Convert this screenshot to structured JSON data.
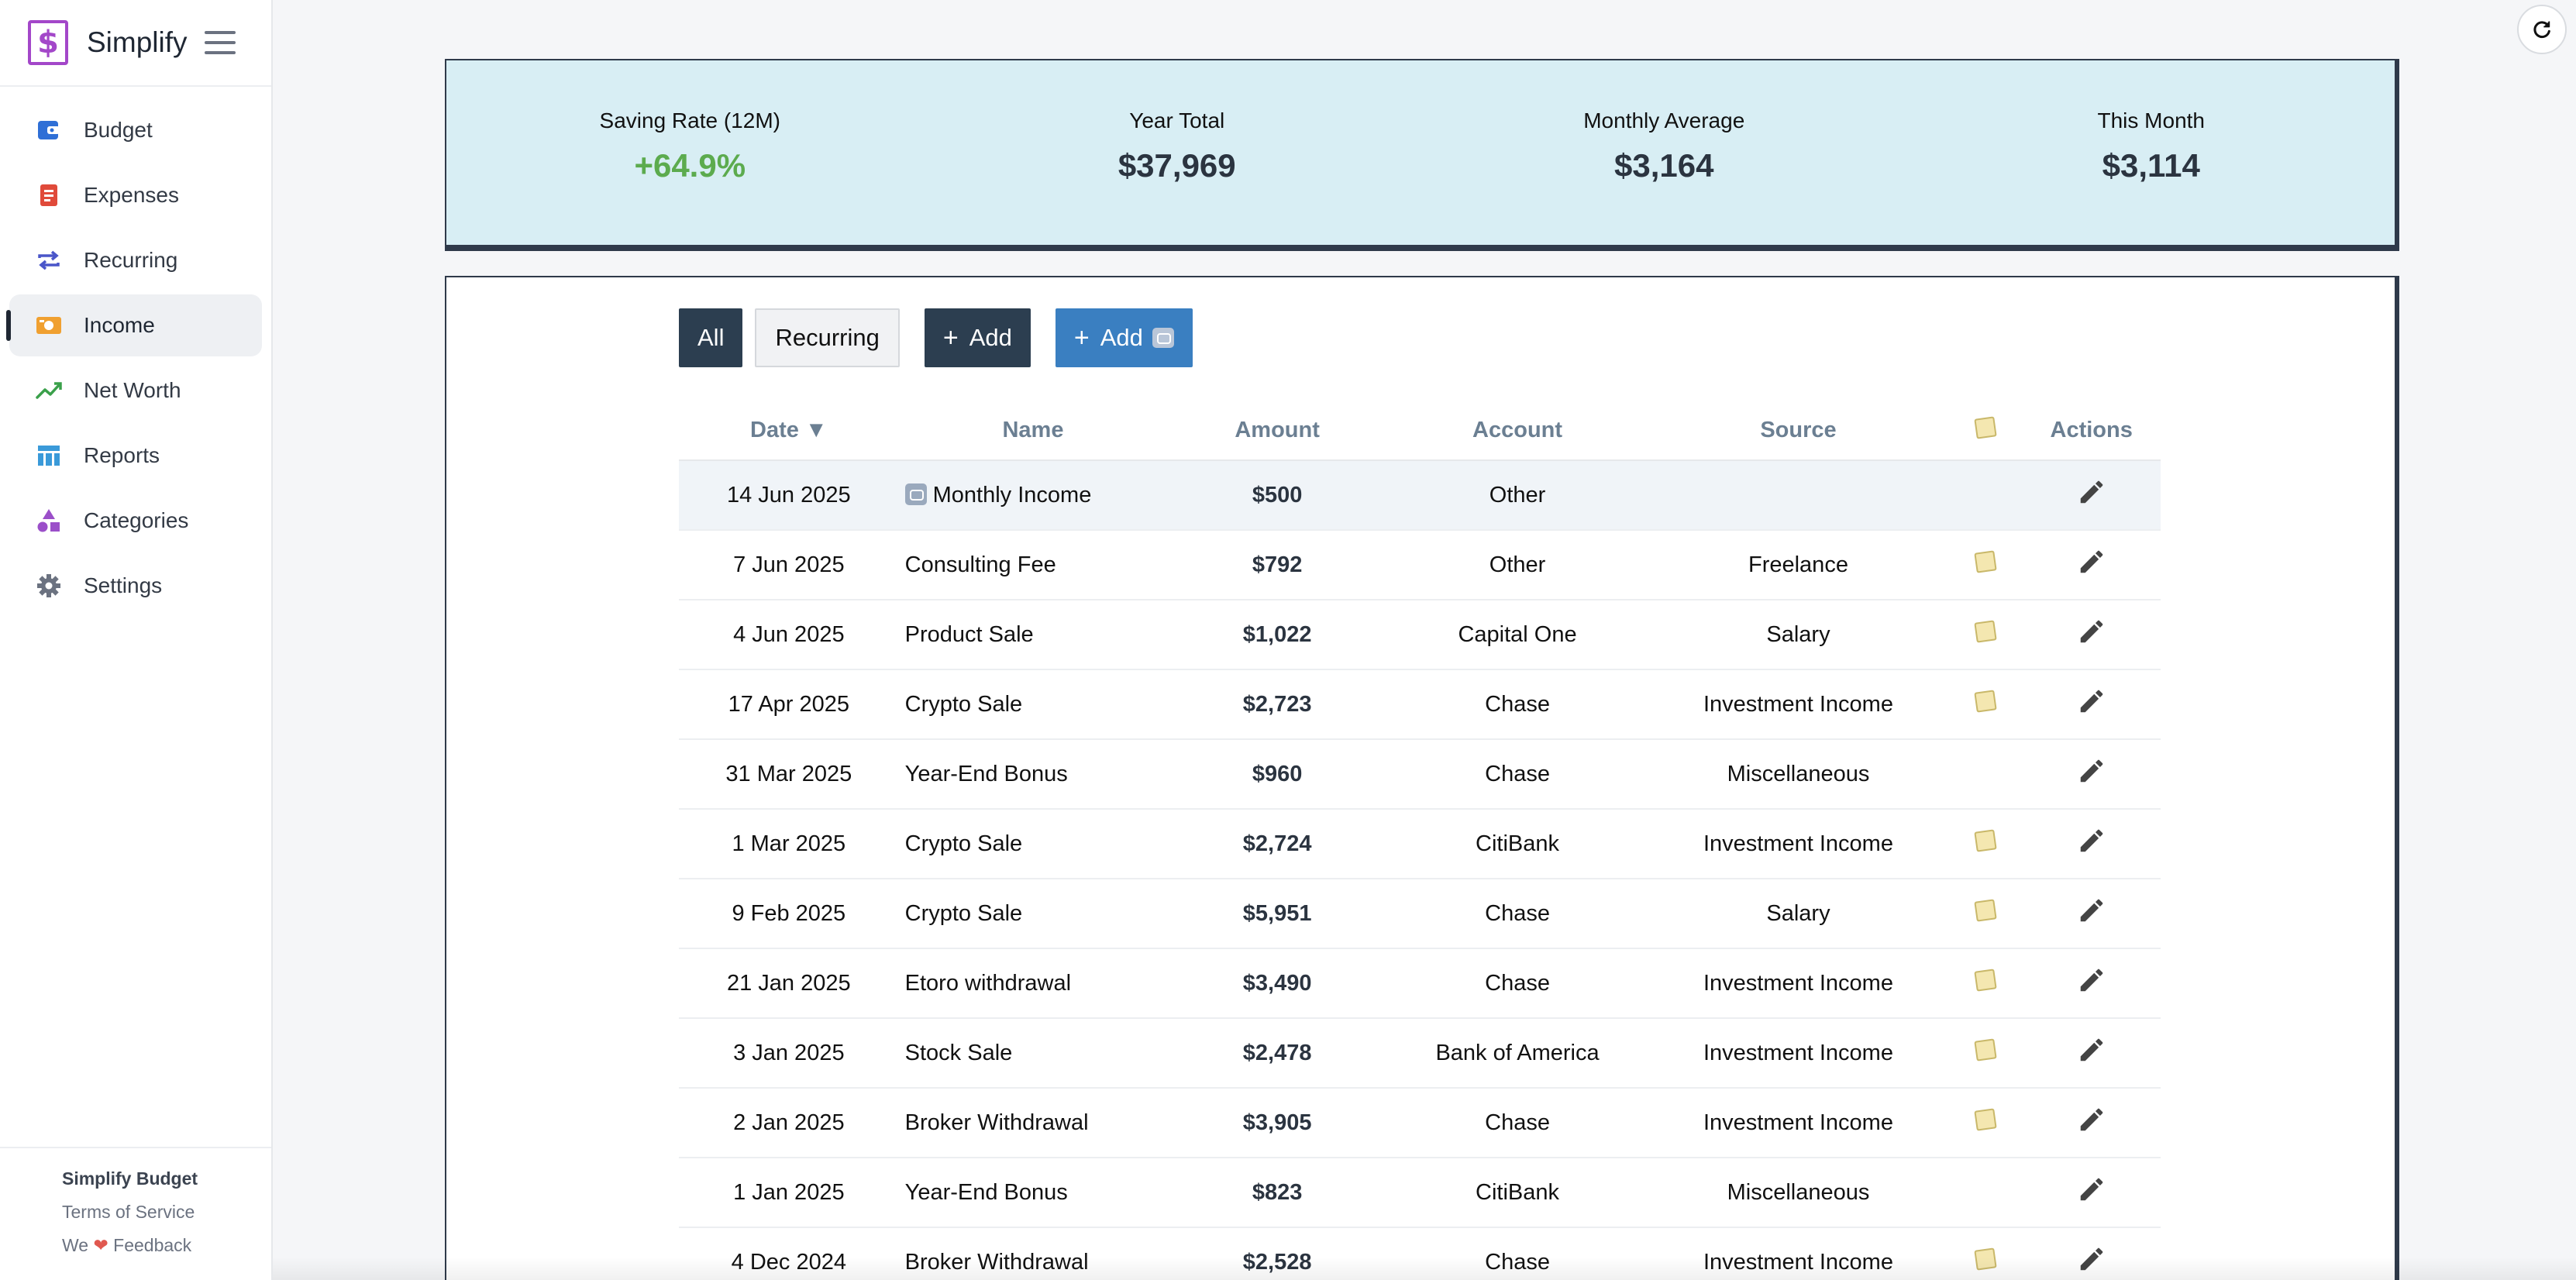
{
  "app": {
    "name": "Simplify"
  },
  "sidebar": {
    "items": [
      {
        "label": "Budget",
        "icon": "wallet-icon",
        "color": "#2f6fd6",
        "active": false
      },
      {
        "label": "Expenses",
        "icon": "receipt-icon",
        "color": "#e04a3a",
        "active": false
      },
      {
        "label": "Recurring",
        "icon": "repeat-icon",
        "color": "#4a56c9",
        "active": false
      },
      {
        "label": "Income",
        "icon": "cash-icon",
        "color": "#f0a030",
        "active": true
      },
      {
        "label": "Net Worth",
        "icon": "trend-up-icon",
        "color": "#3aa04a",
        "active": false
      },
      {
        "label": "Reports",
        "icon": "table-icon",
        "color": "#3a9ad9",
        "active": false
      },
      {
        "label": "Categories",
        "icon": "shapes-icon",
        "color": "#9b4fc9",
        "active": false
      },
      {
        "label": "Settings",
        "icon": "gear-icon",
        "color": "#6b7280",
        "active": false
      }
    ],
    "footer": {
      "title": "Simplify Budget",
      "terms": "Terms of Service",
      "feedback_prefix": "We",
      "feedback_suffix": "Feedback"
    }
  },
  "stats": {
    "saving_rate": {
      "label": "Saving Rate (12M)",
      "value": "+64.9%"
    },
    "year_total": {
      "label": "Year Total",
      "value": "$37,969"
    },
    "monthly_average": {
      "label": "Monthly Average",
      "value": "$3,164"
    },
    "this_month": {
      "label": "This Month",
      "value": "$3,114"
    }
  },
  "toolbar": {
    "all_label": "All",
    "recurring_label": "Recurring",
    "add_label": "Add",
    "add_recurring_label": "Add"
  },
  "table": {
    "headers": {
      "date": "Date ▼",
      "name": "Name",
      "amount": "Amount",
      "account": "Account",
      "source": "Source",
      "actions": "Actions"
    },
    "rows": [
      {
        "date": "14 Jun 2025",
        "name": "Monthly Income",
        "amount": "$500",
        "account": "Other",
        "source": "",
        "note": false,
        "recurring": true
      },
      {
        "date": "7 Jun 2025",
        "name": "Consulting Fee",
        "amount": "$792",
        "account": "Other",
        "source": "Freelance",
        "note": true,
        "recurring": false
      },
      {
        "date": "4 Jun 2025",
        "name": "Product Sale",
        "amount": "$1,022",
        "account": "Capital One",
        "source": "Salary",
        "note": true,
        "recurring": false
      },
      {
        "date": "17 Apr 2025",
        "name": "Crypto Sale",
        "amount": "$2,723",
        "account": "Chase",
        "source": "Investment Income",
        "note": true,
        "recurring": false
      },
      {
        "date": "31 Mar 2025",
        "name": "Year-End Bonus",
        "amount": "$960",
        "account": "Chase",
        "source": "Miscellaneous",
        "note": false,
        "recurring": false
      },
      {
        "date": "1 Mar 2025",
        "name": "Crypto Sale",
        "amount": "$2,724",
        "account": "CitiBank",
        "source": "Investment Income",
        "note": true,
        "recurring": false
      },
      {
        "date": "9 Feb 2025",
        "name": "Crypto Sale",
        "amount": "$5,951",
        "account": "Chase",
        "source": "Salary",
        "note": true,
        "recurring": false
      },
      {
        "date": "21 Jan 2025",
        "name": "Etoro withdrawal",
        "amount": "$3,490",
        "account": "Chase",
        "source": "Investment Income",
        "note": true,
        "recurring": false
      },
      {
        "date": "3 Jan 2025",
        "name": "Stock Sale",
        "amount": "$2,478",
        "account": "Bank of America",
        "source": "Investment Income",
        "note": true,
        "recurring": false
      },
      {
        "date": "2 Jan 2025",
        "name": "Broker Withdrawal",
        "amount": "$3,905",
        "account": "Chase",
        "source": "Investment Income",
        "note": true,
        "recurring": false
      },
      {
        "date": "1 Jan 2025",
        "name": "Year-End Bonus",
        "amount": "$823",
        "account": "CitiBank",
        "source": "Miscellaneous",
        "note": false,
        "recurring": false
      },
      {
        "date": "4 Dec 2024",
        "name": "Broker Withdrawal",
        "amount": "$2,528",
        "account": "Chase",
        "source": "Investment Income",
        "note": true,
        "recurring": false
      }
    ]
  }
}
